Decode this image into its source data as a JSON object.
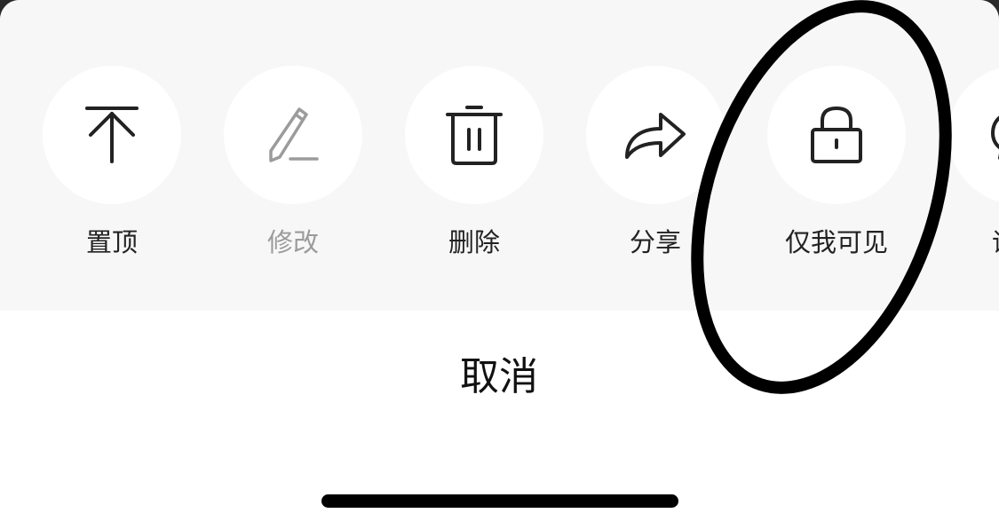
{
  "background_text": "…………………………………………………………",
  "actions": [
    {
      "id": "pin",
      "label": "置顶",
      "icon": "arrow-to-top-icon",
      "enabled": true
    },
    {
      "id": "edit",
      "label": "修改",
      "icon": "pencil-icon",
      "enabled": false
    },
    {
      "id": "delete",
      "label": "删除",
      "icon": "trash-icon",
      "enabled": true
    },
    {
      "id": "share",
      "label": "分享",
      "icon": "share-arrow-icon",
      "enabled": true
    },
    {
      "id": "private",
      "label": "仅我可见",
      "icon": "lock-icon",
      "enabled": true
    },
    {
      "id": "comment",
      "label": "评论",
      "icon": "comment-bubble-icon",
      "enabled": true
    }
  ],
  "cancel_label": "取消",
  "colors": {
    "panel_bg": "#f7f7f7",
    "circle_bg": "#ffffff",
    "icon": "#222222",
    "disabled": "#9b9b9b",
    "annotation": "#000000"
  }
}
